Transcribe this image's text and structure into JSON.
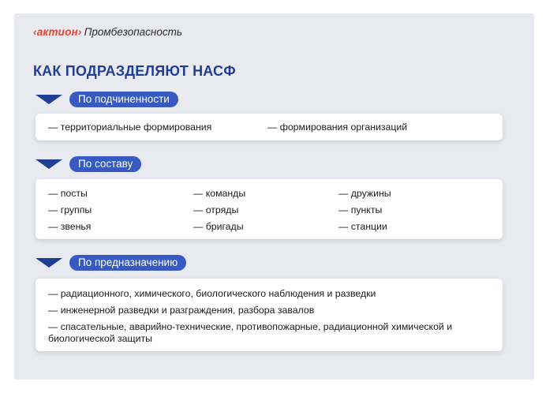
{
  "logo": {
    "brand": "‹актион›",
    "sub": "Промбезопасность"
  },
  "title": "КАК ПОДРАЗДЕЛЯЮТ НАСФ",
  "colors": {
    "accent": "#3659c2",
    "title": "#1f3f94",
    "brand": "#e8432f",
    "background": "#e8eaf0"
  },
  "sections": [
    {
      "label": "По подчиненности",
      "items": [
        "— территориальные формирования",
        "— формирования организаций"
      ]
    },
    {
      "label": "По составу",
      "columns": [
        [
          "— посты",
          "— группы",
          "— звенья"
        ],
        [
          "— команды",
          "— отряды",
          "— бригады"
        ],
        [
          "— дружины",
          "— пункты",
          "— станции"
        ]
      ]
    },
    {
      "label": "По предназначению",
      "items": [
        "— радиационного, химического, биологического наблюдения и разведки",
        "— инженерной разведки и разграждения, разбора завалов",
        "— спасательные, аварийно-технические, противопожарные, радиационной химической и биологической защиты"
      ]
    }
  ]
}
